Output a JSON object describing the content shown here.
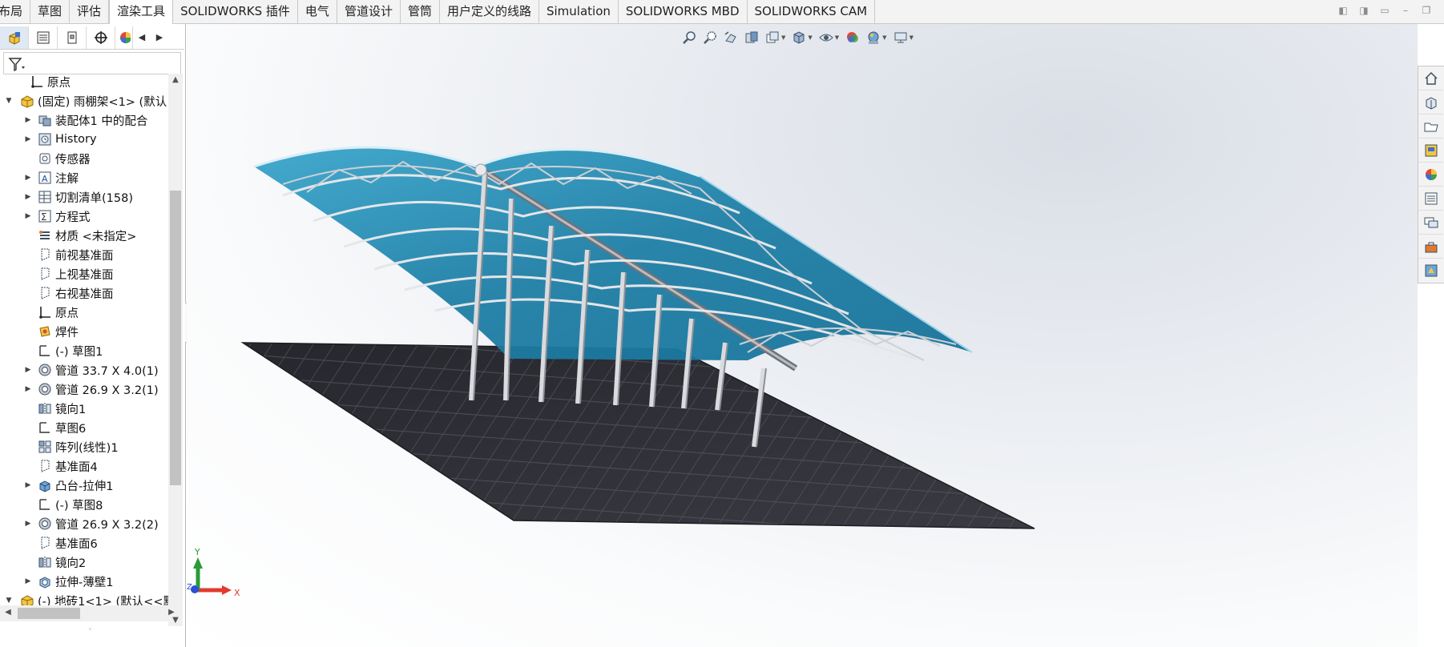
{
  "ribbon": {
    "tabs": [
      "布局",
      "草图",
      "评估",
      "渲染工具",
      "SOLIDWORKS 插件",
      "电气",
      "管道设计",
      "管筒",
      "用户定义的线路",
      "Simulation",
      "SOLIDWORKS MBD",
      "SOLIDWORKS CAM"
    ],
    "active_tab": "渲染工具"
  },
  "feature_tree": {
    "items": [
      {
        "label": "原点",
        "icon": "origin-icon",
        "expandable": false
      },
      {
        "label": "(固定) 雨棚架<1> (默认",
        "icon": "part-icon",
        "expandable": true,
        "expanded": true
      },
      {
        "label": "装配体1 中的配合",
        "icon": "mates-icon",
        "expandable": true
      },
      {
        "label": "History",
        "icon": "history-icon",
        "expandable": true
      },
      {
        "label": "传感器",
        "icon": "sensor-icon",
        "expandable": false
      },
      {
        "label": "注解",
        "icon": "annotation-icon",
        "expandable": true
      },
      {
        "label": "切割清单(158)",
        "icon": "cut-list-icon",
        "expandable": true
      },
      {
        "label": "方程式",
        "icon": "equation-icon",
        "expandable": true
      },
      {
        "label": "材质 <未指定>",
        "icon": "material-icon",
        "expandable": false
      },
      {
        "label": "前视基准面",
        "icon": "plane-icon",
        "expandable": false
      },
      {
        "label": "上视基准面",
        "icon": "plane-icon",
        "expandable": false
      },
      {
        "label": "右视基准面",
        "icon": "plane-icon",
        "expandable": false
      },
      {
        "label": "原点",
        "icon": "origin-icon",
        "expandable": false
      },
      {
        "label": "焊件",
        "icon": "weldment-icon",
        "expandable": false
      },
      {
        "label": "(-) 草图1",
        "icon": "sketch-icon",
        "expandable": false
      },
      {
        "label": "管道 33.7 X 4.0(1)",
        "icon": "structural-member-icon",
        "expandable": true
      },
      {
        "label": "管道 26.9 X 3.2(1)",
        "icon": "structural-member-icon",
        "expandable": true
      },
      {
        "label": "镜向1",
        "icon": "mirror-icon",
        "expandable": false
      },
      {
        "label": "草图6",
        "icon": "sketch-icon",
        "expandable": false
      },
      {
        "label": "阵列(线性)1",
        "icon": "linear-pattern-icon",
        "expandable": false
      },
      {
        "label": "基准面4",
        "icon": "plane-icon",
        "expandable": false
      },
      {
        "label": "凸台-拉伸1",
        "icon": "extrude-icon",
        "expandable": true
      },
      {
        "label": "(-) 草图8",
        "icon": "sketch-icon",
        "expandable": false
      },
      {
        "label": "管道 26.9 X 3.2(2)",
        "icon": "structural-member-icon",
        "expandable": true
      },
      {
        "label": "基准面6",
        "icon": "plane-icon",
        "expandable": false
      },
      {
        "label": "镜向2",
        "icon": "mirror-icon",
        "expandable": false
      },
      {
        "label": "拉伸-薄壁1",
        "icon": "thin-extrude-icon",
        "expandable": true
      },
      {
        "label": "(-) 地砖1<1> (默认<<默",
        "icon": "part-icon",
        "expandable": true,
        "expanded": true
      }
    ]
  },
  "triad": {
    "x_label": "X",
    "y_label": "Y",
    "z_label": "Z"
  },
  "colors": {
    "canopy": "#1f7fa6",
    "floor": "#2f2f36",
    "axis_x": "#e23a2e",
    "axis_y": "#2a9a3a",
    "axis_z": "#2b4fd6"
  }
}
